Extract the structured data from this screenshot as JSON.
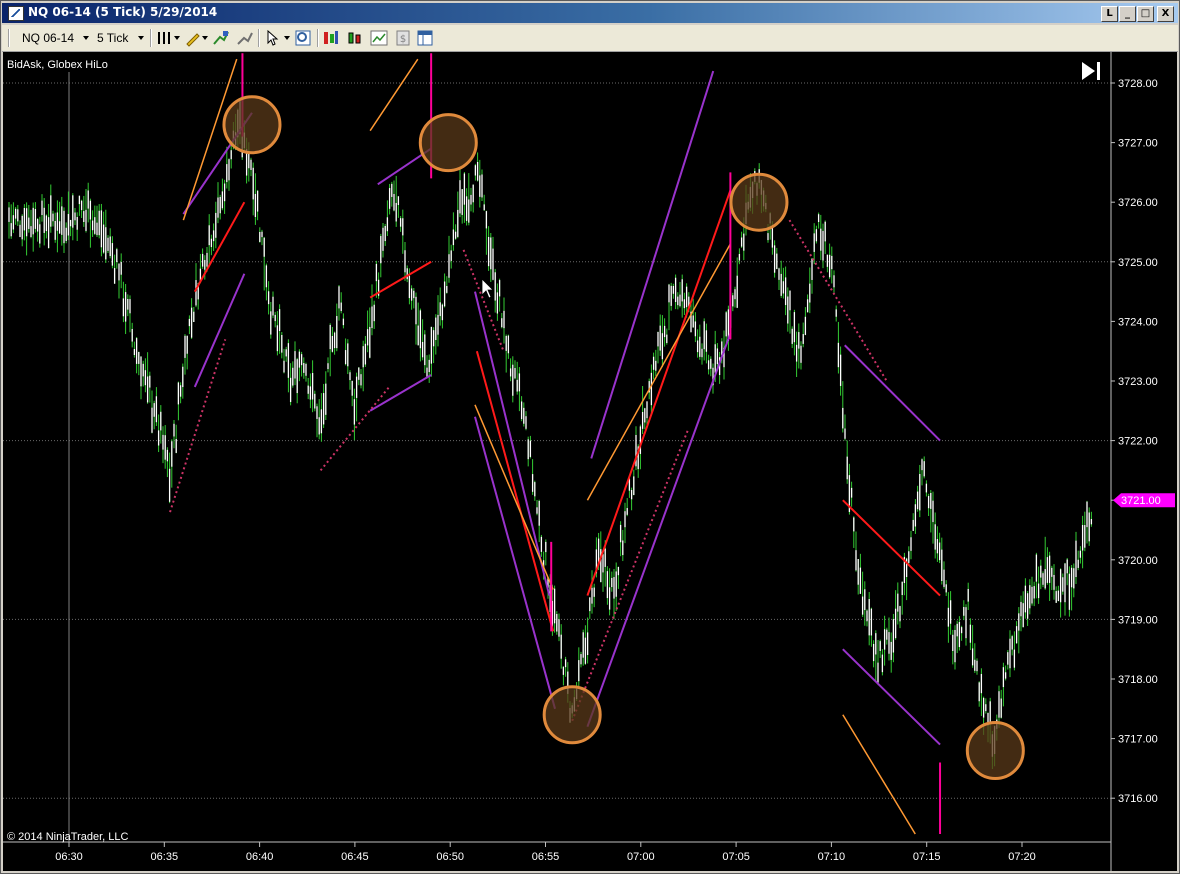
{
  "window": {
    "title": "NQ 06-14 (5 Tick)  5/29/2014",
    "buttons": [
      "L",
      "_",
      "□",
      "X"
    ]
  },
  "toolbar": {
    "instrument": "NQ 06-14",
    "interval": "5 Tick"
  },
  "chart_header": {
    "label": "BidAsk, Globex HiLo"
  },
  "copyright": "© 2014 NinjaTrader, LLC",
  "colors": {
    "background": "#000000",
    "bars": "#ffffff",
    "bar_wicks": "#33cc33",
    "purple": "#9933cc",
    "red": "#ff1a1a",
    "orange": "#ff9933",
    "magenta": "#ff0099",
    "pink_dotted": "#cc3366",
    "circle_fill": "#5a3a1a",
    "circle_stroke": "#e08a3c",
    "price_marker": "#ff00ff"
  },
  "chart_data": {
    "type": "bar",
    "instrument": "NQ 06-14",
    "interval": "5 Tick",
    "date": "5/29/2014",
    "x_ticks": [
      "06:30",
      "06:35",
      "06:40",
      "06:45",
      "06:50",
      "06:55",
      "07:00",
      "07:05",
      "07:10",
      "07:15",
      "07:20"
    ],
    "y_ticks": [
      "3728.00",
      "3727.00",
      "3726.00",
      "3725.00",
      "3724.00",
      "3723.00",
      "3722.00",
      "3721.00",
      "3720.00",
      "3719.00",
      "3718.00",
      "3717.00",
      "3716.00"
    ],
    "ylim": [
      3715.4,
      3728.5
    ],
    "xlim_minutes": [
      0,
      56
    ],
    "current_price": "3721.00",
    "price_path": [
      {
        "t": 0.0,
        "p": 3725.7
      },
      {
        "t": 1.0,
        "p": 3725.9
      },
      {
        "t": 1.8,
        "p": 3725.5
      },
      {
        "t": 2.5,
        "p": 3725.0
      },
      {
        "t": 3.5,
        "p": 3723.5
      },
      {
        "t": 4.5,
        "p": 3722.5
      },
      {
        "t": 5.3,
        "p": 3721.4
      },
      {
        "t": 6.2,
        "p": 3723.7
      },
      {
        "t": 7.0,
        "p": 3725.0
      },
      {
        "t": 8.0,
        "p": 3726.0
      },
      {
        "t": 8.8,
        "p": 3727.3
      },
      {
        "t": 9.6,
        "p": 3726.6
      },
      {
        "t": 10.6,
        "p": 3724.2
      },
      {
        "t": 11.6,
        "p": 3723.0
      },
      {
        "t": 12.3,
        "p": 3723.4
      },
      {
        "t": 13.2,
        "p": 3722.2
      },
      {
        "t": 14.2,
        "p": 3724.4
      },
      {
        "t": 15.0,
        "p": 3722.5
      },
      {
        "t": 16.0,
        "p": 3724.3
      },
      {
        "t": 17.0,
        "p": 3726.2
      },
      {
        "t": 17.8,
        "p": 3724.8
      },
      {
        "t": 18.8,
        "p": 3723.2
      },
      {
        "t": 19.7,
        "p": 3724.4
      },
      {
        "t": 20.5,
        "p": 3726.0
      },
      {
        "t": 21.5,
        "p": 3726.4
      },
      {
        "t": 22.2,
        "p": 3725.0
      },
      {
        "t": 23.0,
        "p": 3723.5
      },
      {
        "t": 24.0,
        "p": 3722.2
      },
      {
        "t": 24.8,
        "p": 3720.3
      },
      {
        "t": 25.8,
        "p": 3718.5
      },
      {
        "t": 26.4,
        "p": 3717.4
      },
      {
        "t": 27.1,
        "p": 3718.6
      },
      {
        "t": 27.8,
        "p": 3720.1
      },
      {
        "t": 28.6,
        "p": 3719.5
      },
      {
        "t": 29.4,
        "p": 3721.0
      },
      {
        "t": 30.2,
        "p": 3722.5
      },
      {
        "t": 31.0,
        "p": 3723.6
      },
      {
        "t": 32.0,
        "p": 3724.6
      },
      {
        "t": 33.0,
        "p": 3723.8
      },
      {
        "t": 33.8,
        "p": 3723.1
      },
      {
        "t": 34.6,
        "p": 3723.8
      },
      {
        "t": 35.5,
        "p": 3725.8
      },
      {
        "t": 36.2,
        "p": 3726.4
      },
      {
        "t": 36.9,
        "p": 3725.2
      },
      {
        "t": 37.7,
        "p": 3724.2
      },
      {
        "t": 38.4,
        "p": 3723.3
      },
      {
        "t": 39.2,
        "p": 3725.6
      },
      {
        "t": 40.0,
        "p": 3725.0
      },
      {
        "t": 40.7,
        "p": 3722.1
      },
      {
        "t": 41.5,
        "p": 3719.6
      },
      {
        "t": 42.4,
        "p": 3718.4
      },
      {
        "t": 43.2,
        "p": 3718.6
      },
      {
        "t": 44.0,
        "p": 3719.9
      },
      {
        "t": 44.8,
        "p": 3721.7
      },
      {
        "t": 45.6,
        "p": 3720.2
      },
      {
        "t": 46.4,
        "p": 3718.7
      },
      {
        "t": 47.2,
        "p": 3719.2
      },
      {
        "t": 47.9,
        "p": 3717.5
      },
      {
        "t": 48.6,
        "p": 3716.9
      },
      {
        "t": 49.3,
        "p": 3718.4
      },
      {
        "t": 50.2,
        "p": 3719.2
      },
      {
        "t": 51.2,
        "p": 3719.8
      },
      {
        "t": 52.2,
        "p": 3719.5
      },
      {
        "t": 53.0,
        "p": 3720.0
      },
      {
        "t": 53.7,
        "p": 3720.9
      }
    ],
    "swing_circles": [
      {
        "t": 9.6,
        "p": 3727.3
      },
      {
        "t": 19.9,
        "p": 3727.0
      },
      {
        "t": 26.4,
        "p": 3717.4
      },
      {
        "t": 36.2,
        "p": 3726.0
      },
      {
        "t": 48.6,
        "p": 3716.8
      }
    ],
    "trend_lines": [
      {
        "color": "purple",
        "style": "solid",
        "from": {
          "t": 6.0,
          "p": 3725.8
        },
        "to": {
          "t": 9.6,
          "p": 3727.5
        }
      },
      {
        "color": "orange",
        "style": "solid",
        "from": {
          "t": 6.0,
          "p": 3725.7
        },
        "to": {
          "t": 8.8,
          "p": 3728.4
        }
      },
      {
        "color": "red",
        "style": "solid",
        "from": {
          "t": 6.6,
          "p": 3724.5
        },
        "to": {
          "t": 9.2,
          "p": 3726.0
        }
      },
      {
        "color": "purple",
        "style": "solid",
        "from": {
          "t": 6.6,
          "p": 3722.9
        },
        "to": {
          "t": 9.2,
          "p": 3724.8
        }
      },
      {
        "color": "pink_dotted",
        "style": "dotted",
        "from": {
          "t": 5.3,
          "p": 3720.8
        },
        "to": {
          "t": 8.2,
          "p": 3723.7
        }
      },
      {
        "color": "magenta",
        "style": "solid",
        "from": {
          "t": 9.1,
          "p": 3728.5
        },
        "to": {
          "t": 9.1,
          "p": 3727.1
        }
      },
      {
        "color": "orange",
        "style": "solid",
        "from": {
          "t": 15.8,
          "p": 3727.2
        },
        "to": {
          "t": 18.3,
          "p": 3728.4
        }
      },
      {
        "color": "purple",
        "style": "solid",
        "from": {
          "t": 16.2,
          "p": 3726.3
        },
        "to": {
          "t": 19.0,
          "p": 3726.9
        }
      },
      {
        "color": "red",
        "style": "solid",
        "from": {
          "t": 15.8,
          "p": 3724.4
        },
        "to": {
          "t": 19.0,
          "p": 3725.0
        }
      },
      {
        "color": "purple",
        "style": "solid",
        "from": {
          "t": 15.8,
          "p": 3722.5
        },
        "to": {
          "t": 19.0,
          "p": 3723.1
        }
      },
      {
        "color": "pink_dotted",
        "style": "dotted",
        "from": {
          "t": 13.2,
          "p": 3721.5
        },
        "to": {
          "t": 16.8,
          "p": 3722.9
        }
      },
      {
        "color": "magenta",
        "style": "solid",
        "from": {
          "t": 19.0,
          "p": 3728.5
        },
        "to": {
          "t": 19.0,
          "p": 3726.4
        }
      },
      {
        "color": "purple",
        "style": "solid",
        "from": {
          "t": 21.3,
          "p": 3724.5
        },
        "to": {
          "t": 25.2,
          "p": 3719.4
        }
      },
      {
        "color": "purple",
        "style": "solid",
        "from": {
          "t": 21.3,
          "p": 3722.4
        },
        "to": {
          "t": 25.5,
          "p": 3717.5
        }
      },
      {
        "color": "red",
        "style": "solid",
        "from": {
          "t": 21.4,
          "p": 3723.5
        },
        "to": {
          "t": 25.4,
          "p": 3718.8
        }
      },
      {
        "color": "orange",
        "style": "solid",
        "from": {
          "t": 21.3,
          "p": 3722.6
        },
        "to": {
          "t": 25.4,
          "p": 3719.5
        }
      },
      {
        "color": "pink_dotted",
        "style": "dotted",
        "from": {
          "t": 20.7,
          "p": 3725.2
        },
        "to": {
          "t": 22.8,
          "p": 3723.5
        }
      },
      {
        "color": "magenta",
        "style": "solid",
        "from": {
          "t": 25.3,
          "p": 3720.3
        },
        "to": {
          "t": 25.3,
          "p": 3718.8
        }
      },
      {
        "color": "purple",
        "style": "solid",
        "from": {
          "t": 27.4,
          "p": 3721.7
        },
        "to": {
          "t": 33.8,
          "p": 3728.2
        }
      },
      {
        "color": "purple",
        "style": "solid",
        "from": {
          "t": 27.2,
          "p": 3717.2
        },
        "to": {
          "t": 34.7,
          "p": 3723.8
        }
      },
      {
        "color": "red",
        "style": "solid",
        "from": {
          "t": 27.2,
          "p": 3719.4
        },
        "to": {
          "t": 34.7,
          "p": 3726.2
        }
      },
      {
        "color": "orange",
        "style": "solid",
        "from": {
          "t": 27.2,
          "p": 3721.0
        },
        "to": {
          "t": 34.7,
          "p": 3725.3
        }
      },
      {
        "color": "pink_dotted",
        "style": "dotted",
        "from": {
          "t": 26.4,
          "p": 3717.3
        },
        "to": {
          "t": 32.5,
          "p": 3722.2
        }
      },
      {
        "color": "magenta",
        "style": "solid",
        "from": {
          "t": 34.7,
          "p": 3726.5
        },
        "to": {
          "t": 34.7,
          "p": 3723.7
        }
      },
      {
        "color": "pink_dotted",
        "style": "dotted",
        "from": {
          "t": 37.8,
          "p": 3725.7
        },
        "to": {
          "t": 42.9,
          "p": 3723.0
        }
      },
      {
        "color": "purple",
        "style": "solid",
        "from": {
          "t": 40.7,
          "p": 3723.6
        },
        "to": {
          "t": 45.7,
          "p": 3722.0
        }
      },
      {
        "color": "red",
        "style": "solid",
        "from": {
          "t": 40.6,
          "p": 3721.0
        },
        "to": {
          "t": 45.7,
          "p": 3719.4
        }
      },
      {
        "color": "purple",
        "style": "solid",
        "from": {
          "t": 40.6,
          "p": 3718.5
        },
        "to": {
          "t": 45.7,
          "p": 3716.9
        }
      },
      {
        "color": "orange",
        "style": "solid",
        "from": {
          "t": 40.6,
          "p": 3717.4
        },
        "to": {
          "t": 44.4,
          "p": 3715.4
        }
      },
      {
        "color": "magenta",
        "style": "solid",
        "from": {
          "t": 45.7,
          "p": 3716.6
        },
        "to": {
          "t": 45.7,
          "p": 3715.4
        }
      }
    ]
  }
}
